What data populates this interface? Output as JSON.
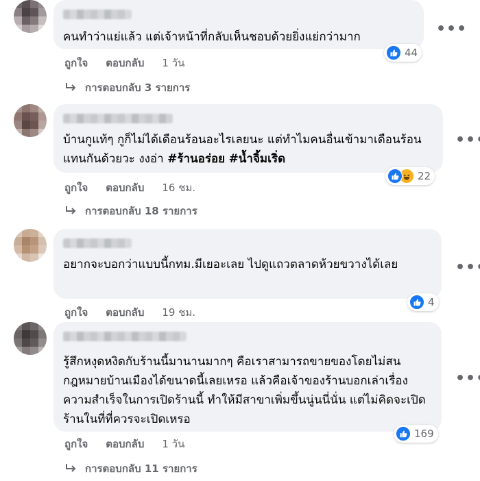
{
  "comments": [
    {
      "text": "คนทำว่าแย่แล้ว แต่เจ้าหน้าที่กลับเห็นชอบด้วยยิ่งแย่กว่ามาก",
      "reaction_count": "44",
      "actions": {
        "like": "ถูกใจ",
        "reply": "ตอบกลับ",
        "time": "1 วัน"
      },
      "replies_label": "การตอบกลับ 3 รายการ"
    },
    {
      "text_plain": "บ้านกูแท้ๆ กูก็ไม่ได้เดือนร้อนอะไรเลยนะ แต่ทำไมคนอื่นเข้ามาเดือนร้อนแทนกันด้วยวะ งงอ่า ",
      "hashtag1": "#ร้านอร่อย",
      "hashtag2": "#น้ำจิ้มเริ่ด",
      "reaction_count": "22",
      "actions": {
        "like": "ถูกใจ",
        "reply": "ตอบกลับ",
        "time": "16 ชม."
      },
      "replies_label": "การตอบกลับ 18 รายการ"
    },
    {
      "text": "อยากจะบอกว่าแบบนี้กทม.มีเยอะเลย ไปดูแถวตลาดห้วยขวางได้เลย",
      "reaction_count": "4",
      "actions": {
        "like": "ถูกใจ",
        "reply": "ตอบกลับ",
        "time": "19 ชม."
      }
    },
    {
      "text": "รู้สึกหงุดหงิดกับร้านนี้มานานมากๆ คือเราสามารถขายของโดยไม่สนกฎหมายบ้านเมืองได้ขนาดนี้เลยเหรอ แล้วคือเจ้าของร้านบอกเล่าเรื่องความสำเร็จในการเปิดร้านนี้ ทำให้มีสาขาเพิ่มขึ้นนู่นนี่นั่น แต่ไม่คิดจะเปิดร้านในที่ที่ควรจะเปิดเหรอ",
      "reaction_count": "169",
      "actions": {
        "like": "ถูกใจ",
        "reply": "ตอบกลับ",
        "time": "1 วัน"
      },
      "replies_label": "การตอบกลับ 11 รายการ"
    }
  ],
  "more_icon": "more-horizontal-icon",
  "colors": {
    "like_blue": "#1877f2",
    "haha_yellow": "#f7b125",
    "bubble_bg": "#f0f2f5",
    "meta_gray": "#65676b"
  }
}
